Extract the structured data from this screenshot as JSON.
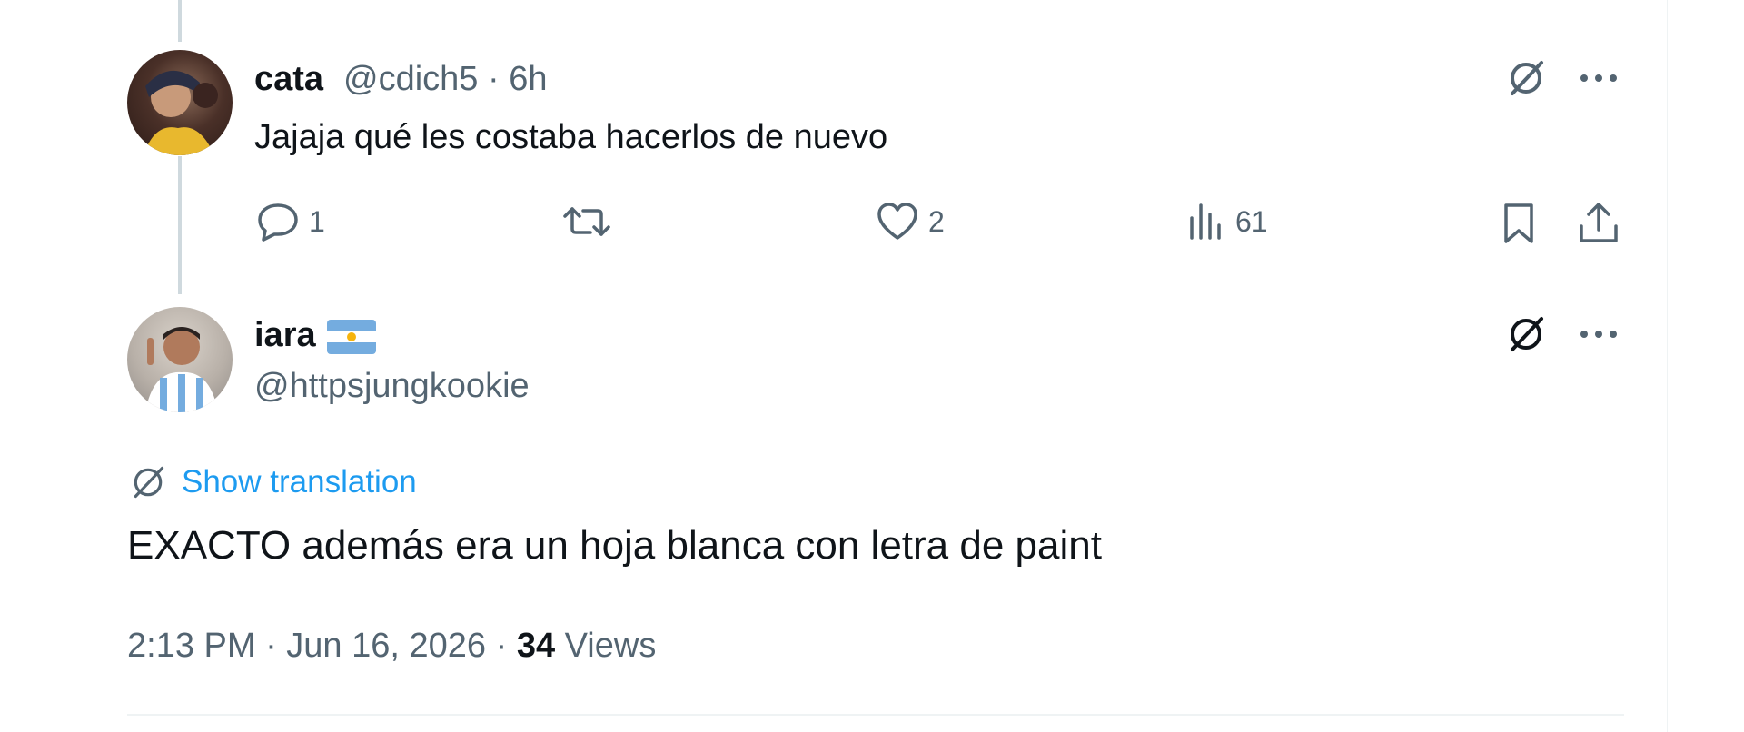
{
  "colors": {
    "accent": "#1d9bf0",
    "muted": "#536471",
    "text": "#0f1419",
    "thread_line": "#cfd9de"
  },
  "reply1": {
    "avatar": "avatar-cata",
    "name": "cata",
    "handle_time": "@cdich5 · 6h",
    "text": "Jajaja qué les costaba hacerlos de nuevo",
    "replies": "1",
    "reposts": "",
    "likes": "2",
    "views": "61"
  },
  "reply2": {
    "avatar": "avatar-iara",
    "name": "iara",
    "flag": "argentina-flag",
    "handle": "@httpsjungkookie",
    "translate_label": "Show translation",
    "text": "EXACTO además era un hoja blanca con letra de paint",
    "time_date": "2:13 PM · Jun 16, 2026 · ",
    "views_count": "34",
    "views_label": " Views"
  }
}
